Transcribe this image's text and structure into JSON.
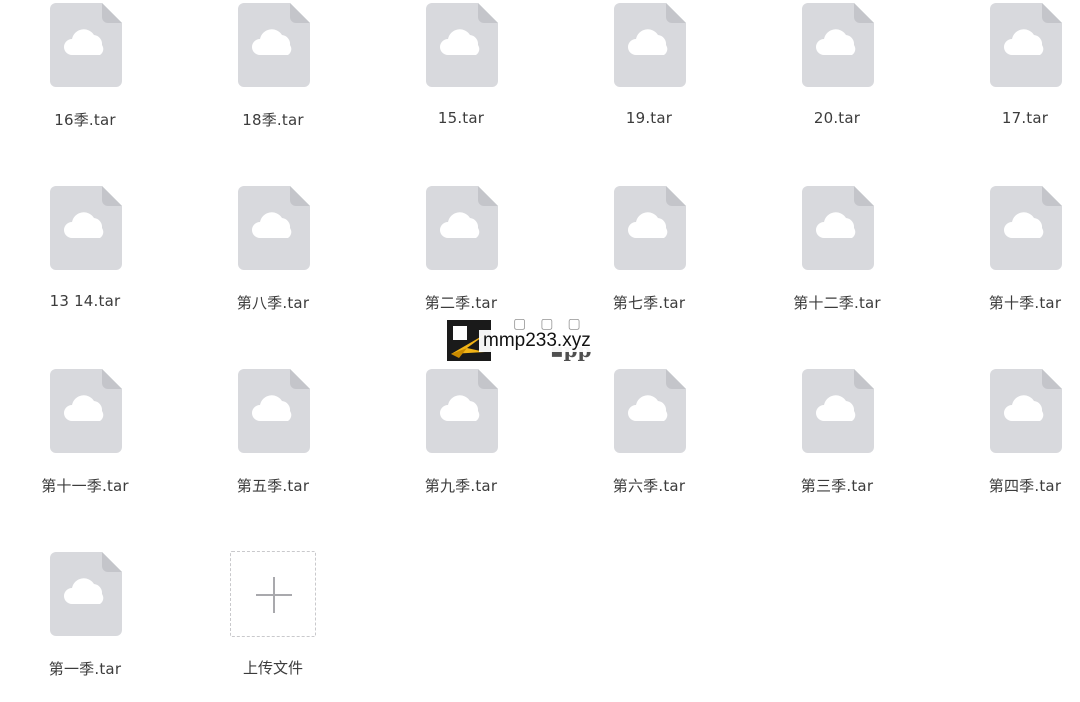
{
  "files": [
    {
      "name": "16季.tar",
      "icon": "cloud-file-icon"
    },
    {
      "name": "18季.tar",
      "icon": "cloud-file-icon"
    },
    {
      "name": "15.tar",
      "icon": "cloud-file-icon"
    },
    {
      "name": "19.tar",
      "icon": "cloud-file-icon"
    },
    {
      "name": "20.tar",
      "icon": "cloud-file-icon"
    },
    {
      "name": "17.tar",
      "icon": "cloud-file-icon"
    },
    {
      "name": "13 14.tar",
      "icon": "cloud-file-icon"
    },
    {
      "name": "第八季.tar",
      "icon": "cloud-file-icon"
    },
    {
      "name": "第二季.tar",
      "icon": "cloud-file-icon"
    },
    {
      "name": "第七季.tar",
      "icon": "cloud-file-icon"
    },
    {
      "name": "第十二季.tar",
      "icon": "cloud-file-icon"
    },
    {
      "name": "第十季.tar",
      "icon": "cloud-file-icon"
    },
    {
      "name": "第十一季.tar",
      "icon": "cloud-file-icon"
    },
    {
      "name": "第五季.tar",
      "icon": "cloud-file-icon"
    },
    {
      "name": "第九季.tar",
      "icon": "cloud-file-icon"
    },
    {
      "name": "第六季.tar",
      "icon": "cloud-file-icon"
    },
    {
      "name": "第三季.tar",
      "icon": "cloud-file-icon"
    },
    {
      "name": "第四季.tar",
      "icon": "cloud-file-icon"
    },
    {
      "name": "第一季.tar",
      "icon": "cloud-file-icon"
    }
  ],
  "upload": {
    "label": "上传文件",
    "icon": "plus-icon"
  },
  "watermark": {
    "text": "mmp233.xyz"
  },
  "colors": {
    "file_icon_fill": "#d8d9dd",
    "file_icon_fold": "#c4c5ca",
    "cloud": "#ffffff",
    "label_text": "#3c3c3c"
  }
}
